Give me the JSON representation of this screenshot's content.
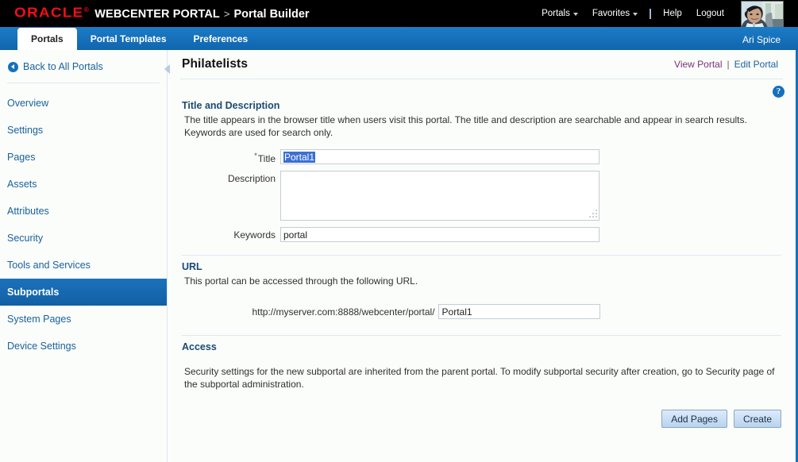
{
  "branding": {
    "oracle_logo": "ORACLE",
    "logo_sup": "®",
    "product_name": "WEBCENTER PORTAL",
    "separator": ">",
    "sub_product": "Portal Builder",
    "global_links": [
      {
        "label": "Portals",
        "has_caret": true,
        "icon": "chevron-down-icon"
      },
      {
        "label": "Favorites",
        "has_caret": true,
        "icon": "chevron-down-icon"
      },
      {
        "label": "Help",
        "has_caret": false
      },
      {
        "label": "Logout",
        "has_caret": false
      }
    ],
    "avatar_alt": "user-avatar-photo"
  },
  "tab_bar": {
    "tabs": [
      {
        "label": "Portals",
        "active": true
      },
      {
        "label": "Portal Templates",
        "active": false
      },
      {
        "label": "Preferences",
        "active": false
      }
    ],
    "user_name": "Ari Spice"
  },
  "sidebar": {
    "back_link": {
      "label": "Back to All Portals",
      "icon": "circle-back-arrow-icon"
    },
    "items": [
      {
        "label": "Overview",
        "selected": false
      },
      {
        "label": "Settings",
        "selected": false
      },
      {
        "label": "Pages",
        "selected": false
      },
      {
        "label": "Assets",
        "selected": false
      },
      {
        "label": "Attributes",
        "selected": false
      },
      {
        "label": "Security",
        "selected": false
      },
      {
        "label": "Tools and Services",
        "selected": false
      },
      {
        "label": "Subportals",
        "selected": true
      },
      {
        "label": "System Pages",
        "selected": false
      },
      {
        "label": "Device Settings",
        "selected": false
      }
    ],
    "collapse_icon": "chevron-left-icon"
  },
  "page": {
    "title": "Philatelists",
    "actions": {
      "view_portal": "View Portal",
      "separator": "|",
      "edit_portal": "Edit Portal"
    },
    "help_icon_glyph": "?"
  },
  "title_description_section": {
    "heading": "Title and Description",
    "description": "The title appears in the browser title when users visit this portal. The title and description are searchable and appear in search results. Keywords are used for search only.",
    "fields": {
      "title": {
        "label": "Title",
        "required_marker": "*",
        "value": "Portal1",
        "placeholder": "",
        "selected_text": "Portal1"
      },
      "description": {
        "label": "Description",
        "value": "",
        "placeholder": ""
      },
      "keywords": {
        "label": "Keywords",
        "value": "portal",
        "placeholder": ""
      }
    }
  },
  "url_section": {
    "heading": "URL",
    "description": "This portal can be accessed through the following URL.",
    "url_prefix": "http://myserver.com:8888/webcenter/portal/",
    "url_value": "Portal1",
    "url_placeholder": ""
  },
  "access_section": {
    "heading": "Access",
    "description": "Security settings for the new subportal are inherited from the parent portal. To modify subportal security after creation, go to Security page of the subportal administration."
  },
  "buttons": {
    "add_pages": "Add Pages",
    "create": "Create"
  },
  "colors": {
    "brand_red": "#f20d18",
    "header_black": "#000000",
    "accent_blue": "#1670bd",
    "selected_nav_blue": "#1568af",
    "link_blue": "#19619f",
    "visited_link_purple": "#7b2f7b",
    "section_heading_navy": "#1b4a73",
    "selection_blue": "#3b6fd4",
    "button_blue": "#c7dcf3",
    "sidebar_bg": "#fbfdfa"
  }
}
